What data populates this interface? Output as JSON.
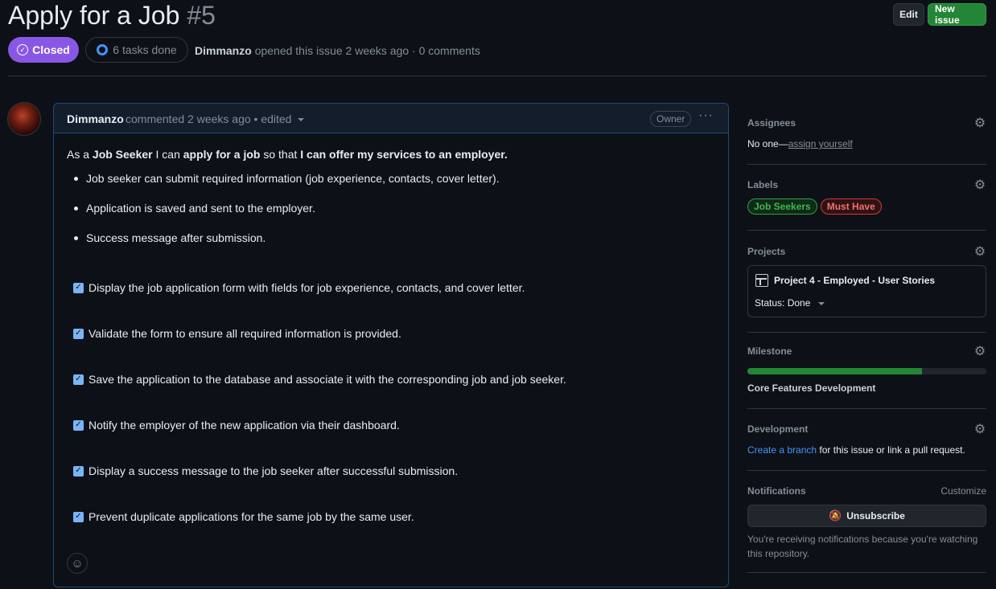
{
  "header": {
    "title": "Apply for a Job",
    "number": "#5",
    "edit_label": "Edit",
    "new_issue_label": "New issue",
    "state": "Closed",
    "tasks": "6 tasks done",
    "author": "Dimmanzo",
    "meta_rest": "opened this issue 2 weeks ago · 0 comments"
  },
  "comment": {
    "author": "Dimmanzo",
    "meta": "commented 2 weeks ago • edited",
    "role_badge": "Owner",
    "intro": {
      "p1": "As a ",
      "b1": "Job Seeker",
      "p2": " I can ",
      "b2": "apply for a job",
      "p3": " so that ",
      "b3": "I can offer my services to an employer."
    },
    "bullets": [
      "Job seeker can submit required information (job experience, contacts, cover letter).",
      "Application is saved and sent to the employer.",
      "Success message after submission."
    ],
    "tasks": [
      "Display the job application form with fields for job experience, contacts, and cover letter.",
      "Validate the form to ensure all required information is provided.",
      "Save the application to the database and associate it with the corresponding job and job seeker.",
      "Notify the employer of the new application via their dashboard.",
      "Display a success message to the job seeker after successful submission.",
      "Prevent duplicate applications for the same job by the same user."
    ]
  },
  "sidebar": {
    "assignees": {
      "title": "Assignees",
      "value": "No one—",
      "link": "assign yourself"
    },
    "labels": {
      "title": "Labels",
      "items": [
        {
          "name": "Job Seekers",
          "color": "#3fb950",
          "bg": "#0f2a17",
          "border": "#2ea043"
        },
        {
          "name": "Must Have",
          "color": "#f47067",
          "bg": "#2d1216",
          "border": "#da3633"
        }
      ]
    },
    "projects": {
      "title": "Projects",
      "name": "Project 4 - Employed - User Stories",
      "status": "Status: Done"
    },
    "milestone": {
      "title": "Milestone",
      "name": "Core Features Development",
      "progress": 0.73
    },
    "development": {
      "title": "Development",
      "link": "Create a branch",
      "rest": " for this issue or link a pull request."
    },
    "notifications": {
      "title": "Notifications",
      "customize": "Customize",
      "button": "Unsubscribe",
      "note": "You're receiving notifications because you're watching this repository."
    }
  }
}
